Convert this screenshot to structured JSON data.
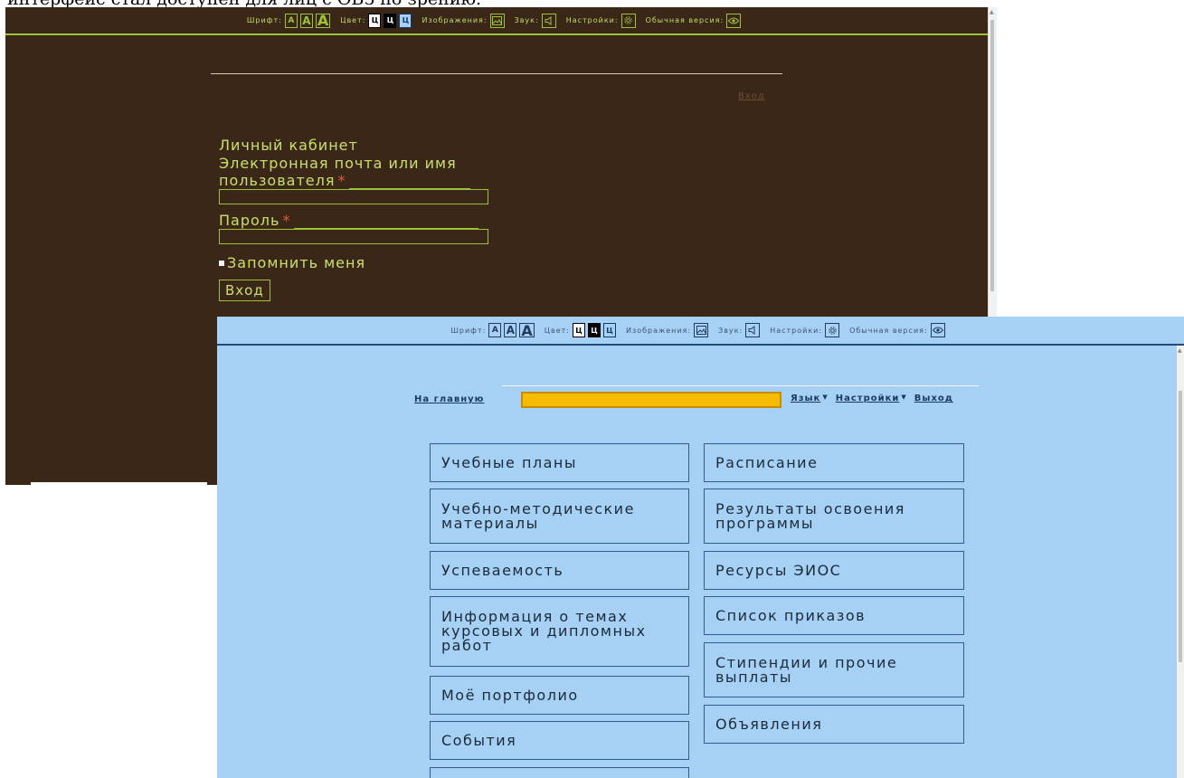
{
  "caption_fragment": "интерфейс стал доступен для лиц с ОВЗ по зрению.",
  "dark_window": {
    "toolbar": {
      "font_label": "Шрифт:",
      "font_sizes": [
        "A",
        "A",
        "A"
      ],
      "color_label": "Цвет:",
      "color_options": [
        "Ц",
        "Ц",
        "Ц"
      ],
      "images_label": "Изображения:",
      "sound_label": "Звук:",
      "settings_label": "Настройки:",
      "normal_version_label": "Обычная версия:"
    },
    "top_login_link": "Вход",
    "form": {
      "title": "Личный кабинет",
      "username_label_line1": "Электронная почта или имя",
      "username_label_line2": "пользователя",
      "password_label": "Пароль",
      "required_mark": "*",
      "remember_label": "Запомнить меня",
      "submit_label": "Вход"
    }
  },
  "light_window": {
    "toolbar": {
      "font_label": "Шрифт:",
      "font_sizes": [
        "A",
        "A",
        "A"
      ],
      "color_label": "Цвет:",
      "color_options": [
        "Ц",
        "Ц",
        "Ц"
      ],
      "images_label": "Изображения:",
      "sound_label": "Звук:",
      "settings_label": "Настройки:",
      "normal_version_label": "Обычная версия:"
    },
    "nav": {
      "home": "На главную",
      "language": "Язык",
      "settings": "Настройки",
      "logout": "Выход"
    },
    "menu_left": [
      [
        "Учебные планы"
      ],
      [
        "Учебно-методические",
        "материалы"
      ],
      [
        "Успеваемость"
      ],
      [
        "Информация о темах",
        "курсовых и дипломных",
        "работ"
      ],
      [
        "Моё портфолио"
      ],
      [
        "События"
      ],
      [
        ""
      ]
    ],
    "menu_right": [
      [
        "Расписание"
      ],
      [
        "Результаты освоения",
        "программы"
      ],
      [
        "Ресурсы ЭИОС"
      ],
      [
        "Список приказов"
      ],
      [
        "Стипендии и прочие",
        "выплаты"
      ],
      [
        "Объявления"
      ]
    ]
  },
  "colors": {
    "dark_bg": "#3b2718",
    "dark_accent": "#9bc43a",
    "dark_text": "#c9e06b",
    "light_bg": "#a6d1f4",
    "search_fill": "#f5bc02"
  },
  "icons": [
    "image-icon",
    "speaker-icon",
    "gear-icon",
    "eye-icon"
  ]
}
